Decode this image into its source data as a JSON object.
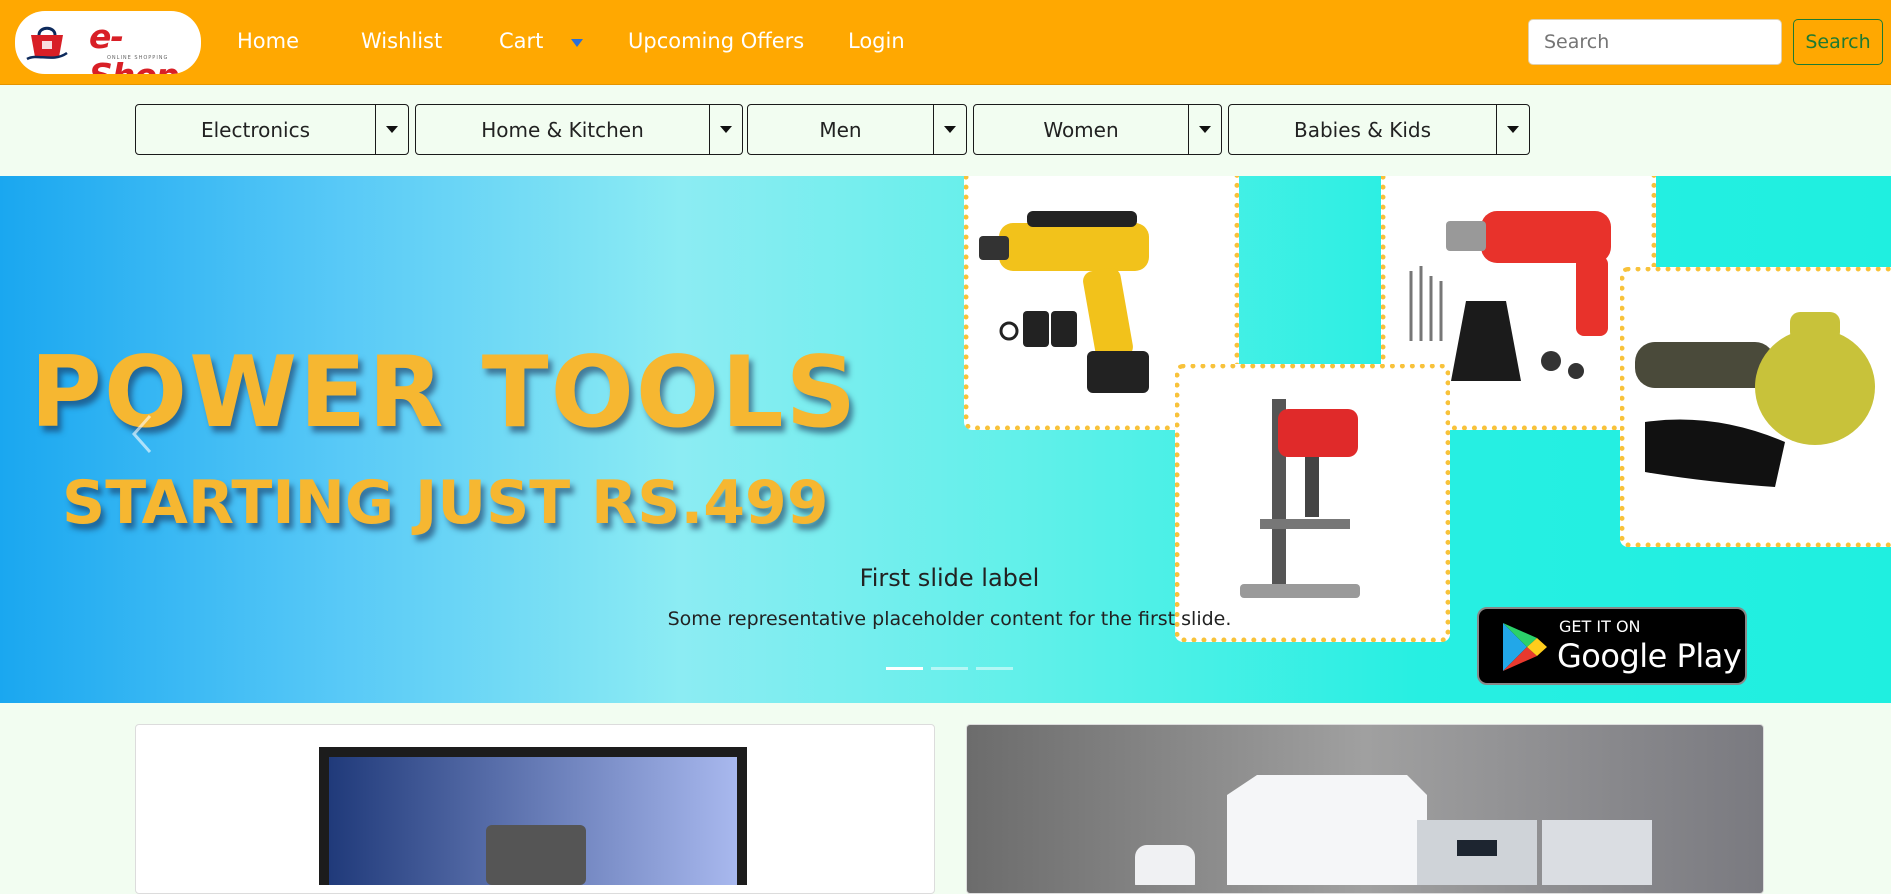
{
  "brand": {
    "logo_text": "e-Shop",
    "tagline": "ONLINE SHOPPING"
  },
  "nav": {
    "links": [
      {
        "label": "Home"
      },
      {
        "label": "Wishlist"
      },
      {
        "label": "Cart"
      },
      {
        "label": "Upcoming Offers"
      },
      {
        "label": "Login"
      }
    ]
  },
  "search": {
    "placeholder": "Search",
    "button_label": "Search"
  },
  "categories": [
    {
      "label": "Electronics"
    },
    {
      "label": "Home & Kitchen"
    },
    {
      "label": "Men"
    },
    {
      "label": "Women"
    },
    {
      "label": "Babies & Kids"
    }
  ],
  "carousel": {
    "banner_line1": "POWER TOOLS",
    "banner_line2": "STARTING JUST RS.499",
    "caption_title": "First slide label",
    "caption_text": "Some representative placeholder content for the first slide.",
    "slide_count": 3,
    "active_slide": 1,
    "badge_small": "GET IT ON",
    "badge_big": "Google Play"
  },
  "colors": {
    "navbar": "#ffa801",
    "page_bg": "#f2fdf1",
    "search_button": "#1e7a32",
    "banner_text": "#f6b731",
    "cart_caret": "#2a6fd8"
  }
}
